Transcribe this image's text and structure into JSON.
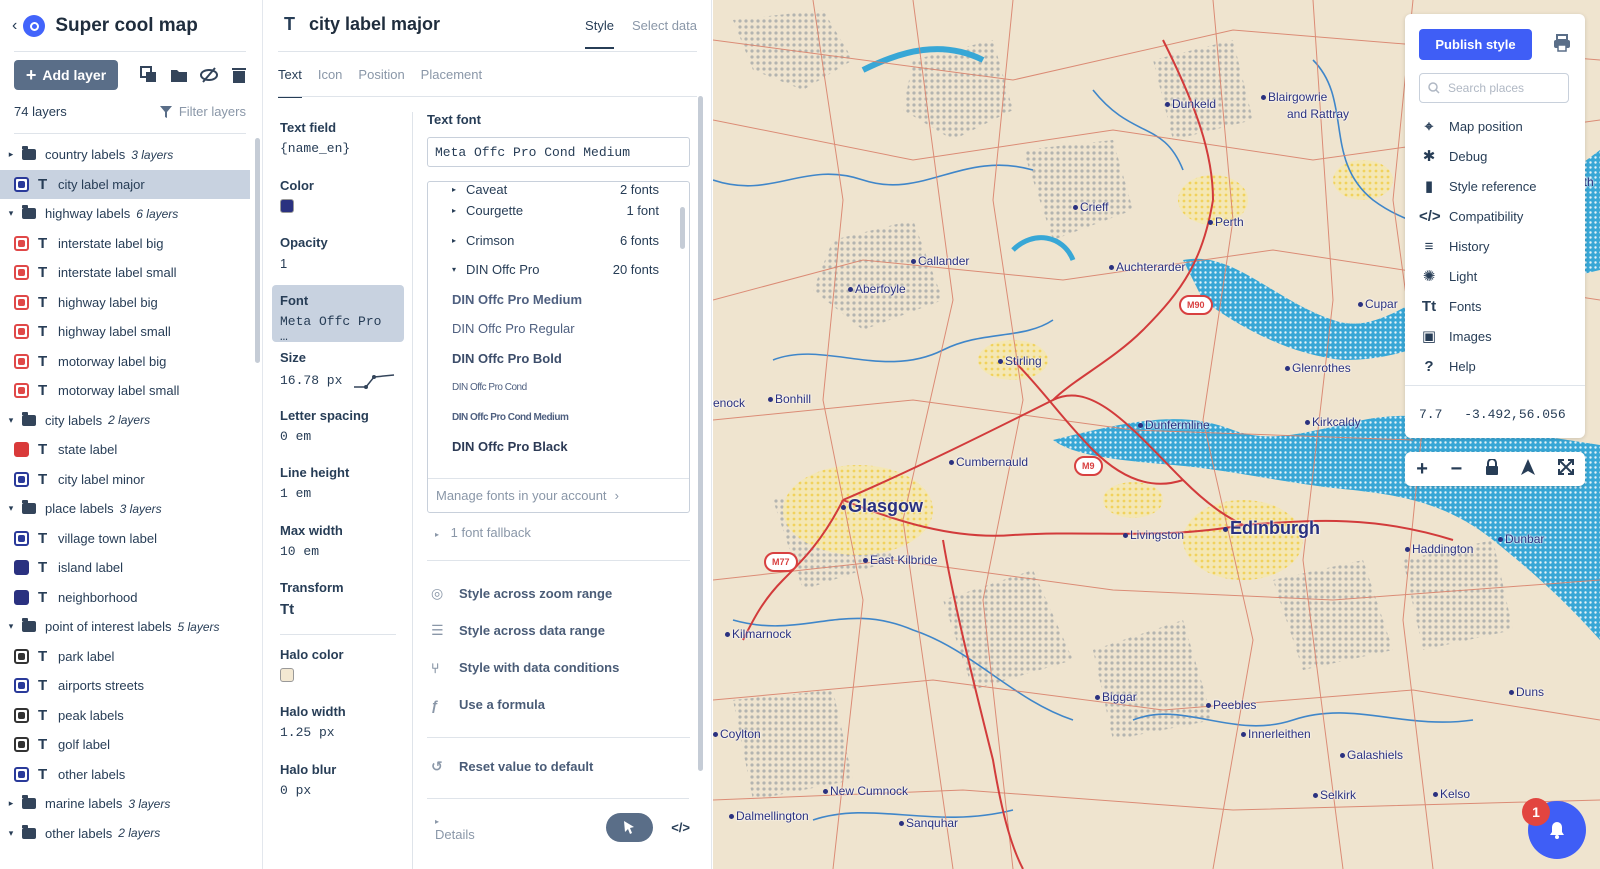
{
  "app": {
    "title": "Super cool map",
    "back_glyph": "‹"
  },
  "layers_panel": {
    "add_layer_label": "Add layer",
    "layer_count": "74 layers",
    "filter_label": "Filter layers",
    "items": [
      {
        "kind": "group",
        "caret": "▸",
        "label": "country labels",
        "count": "3 layers"
      },
      {
        "kind": "layer",
        "swatch": "blue",
        "label": "city label major",
        "selected": true
      },
      {
        "kind": "group",
        "caret": "▾",
        "label": "highway labels",
        "count": "6 layers"
      },
      {
        "kind": "layer",
        "swatch": "red",
        "label": "interstate label big"
      },
      {
        "kind": "layer",
        "swatch": "red",
        "label": "interstate label small"
      },
      {
        "kind": "layer",
        "swatch": "red",
        "label": "highway label big"
      },
      {
        "kind": "layer",
        "swatch": "red",
        "label": "highway label small"
      },
      {
        "kind": "layer",
        "swatch": "red",
        "label": "motorway label big"
      },
      {
        "kind": "layer",
        "swatch": "red",
        "label": "motorway label small"
      },
      {
        "kind": "group",
        "caret": "▾",
        "label": "city labels",
        "count": "2 layers"
      },
      {
        "kind": "layer",
        "swatch": "fill-red",
        "label": "state label"
      },
      {
        "kind": "layer",
        "swatch": "blue",
        "label": "city label minor"
      },
      {
        "kind": "group",
        "caret": "▾",
        "label": "place labels",
        "count": "3 layers"
      },
      {
        "kind": "layer",
        "swatch": "blue",
        "label": "village town label"
      },
      {
        "kind": "layer",
        "swatch": "fill-navy",
        "label": "island label"
      },
      {
        "kind": "layer",
        "swatch": "fill-navy",
        "label": "neighborhood"
      },
      {
        "kind": "group",
        "caret": "▾",
        "label": "point of interest labels",
        "count": "5 layers"
      },
      {
        "kind": "layer",
        "swatch": "dark",
        "label": "park label"
      },
      {
        "kind": "layer",
        "swatch": "blue",
        "label": "airports streets"
      },
      {
        "kind": "layer",
        "swatch": "dark",
        "label": "peak labels"
      },
      {
        "kind": "layer",
        "swatch": "dark",
        "label": "golf label"
      },
      {
        "kind": "layer",
        "swatch": "blue",
        "label": "other labels"
      },
      {
        "kind": "group",
        "caret": "▸",
        "label": "marine labels",
        "count": "3 layers"
      },
      {
        "kind": "group",
        "caret": "▾",
        "label": "other labels",
        "count": "2 layers"
      }
    ]
  },
  "editor": {
    "layer_name": "city label major",
    "type_glyph": "T",
    "top_tabs": [
      "Style",
      "Select data"
    ],
    "tabs": [
      "Text",
      "Icon",
      "Position",
      "Placement"
    ],
    "properties": [
      {
        "label": "Text field",
        "value": "{name_en}",
        "mono": true
      },
      {
        "label": "Color",
        "color": "#2a3180"
      },
      {
        "label": "Opacity",
        "value": "1"
      },
      {
        "label": "Font",
        "value": "Meta Offc Pro …",
        "mono": true,
        "active": true
      },
      {
        "label": "Size",
        "value": "16.78 px",
        "mono": true,
        "curve": true
      },
      {
        "label": "Letter spacing",
        "value": "0 em",
        "mono": true
      },
      {
        "label": "Line height",
        "value": "1 em",
        "mono": true
      },
      {
        "label": "Max width",
        "value": "10 em",
        "mono": true
      },
      {
        "label": "Transform",
        "glyph": "Tt"
      },
      {
        "label": "Halo color",
        "color": "#f3e8d2"
      },
      {
        "label": "Halo width",
        "value": "1.25 px",
        "mono": true
      },
      {
        "label": "Halo blur",
        "value": "0 px",
        "mono": true
      }
    ],
    "font_section": {
      "label": "Text font",
      "input_value": "Meta Offc Pro Cond Medium",
      "families": [
        {
          "caret": "▸",
          "name": "Caveat",
          "count": "2 fonts"
        },
        {
          "caret": "▸",
          "name": "Courgette",
          "count": "1 font"
        },
        {
          "caret": "▸",
          "name": "Crimson",
          "count": "6 fonts"
        },
        {
          "caret": "▾",
          "name": "DIN Offc Pro",
          "count": "20 fonts"
        }
      ],
      "fonts": [
        {
          "name": "DIN Offc Pro Medium",
          "style": "med"
        },
        {
          "name": "DIN Offc Pro Regular",
          "style": ""
        },
        {
          "name": "DIN Offc Pro Bold",
          "style": "bold"
        },
        {
          "name": "DIN Offc Pro Cond",
          "style": "cond"
        },
        {
          "name": "DIN Offc Pro Cond Medium",
          "style": "condmed"
        },
        {
          "name": "DIN Offc Pro Black",
          "style": "black"
        }
      ],
      "manage_label": "Manage fonts in your account",
      "fallback_label": "1 font fallback"
    },
    "actions": [
      {
        "icon": "zoom-range-icon",
        "glyph": "◎",
        "label": "Style across zoom range"
      },
      {
        "icon": "data-range-icon",
        "glyph": "☰",
        "label": "Style across data range"
      },
      {
        "icon": "data-conditions-icon",
        "glyph": "⑂",
        "label": "Style with data conditions"
      },
      {
        "icon": "formula-icon",
        "glyph": "ƒ",
        "label": "Use a formula"
      }
    ],
    "reset_label": "Reset value to default",
    "reset_glyph": "↺",
    "details_label": "Details",
    "code_label": "</>"
  },
  "map": {
    "overlay": {
      "publish_label": "Publish style",
      "search_placeholder": "Search places",
      "menu": [
        {
          "icon": "target-icon",
          "glyph": "⌖",
          "label": "Map position"
        },
        {
          "icon": "bug-icon",
          "glyph": "✱",
          "label": "Debug"
        },
        {
          "icon": "book-icon",
          "glyph": "▮",
          "label": "Style reference"
        },
        {
          "icon": "code-icon",
          "glyph": "</>",
          "label": "Compatibility"
        },
        {
          "icon": "history-icon",
          "glyph": "≡",
          "label": "History"
        },
        {
          "icon": "light-icon",
          "glyph": "✺",
          "label": "Light"
        },
        {
          "icon": "fonts-icon",
          "glyph": "Tt",
          "label": "Fonts"
        },
        {
          "icon": "images-icon",
          "glyph": "▣",
          "label": "Images"
        },
        {
          "icon": "help-icon",
          "glyph": "?",
          "label": "Help"
        }
      ],
      "zoom": "7.7",
      "coordinates": "-3.492,56.056"
    },
    "controls": {
      "zoom_in": "+",
      "zoom_out": "−",
      "lock": "🔒",
      "compass": "➤",
      "fullscreen": "⤢"
    },
    "notification_count": "1",
    "cities": [
      {
        "name": "Glasgow",
        "big": true
      },
      {
        "name": "Edinburgh",
        "big": true
      },
      {
        "name": "Dunkeld"
      },
      {
        "name": "Blairgowrie"
      },
      {
        "name": "and Rattray"
      },
      {
        "name": "Crieff"
      },
      {
        "name": "Perth"
      },
      {
        "name": "Callander"
      },
      {
        "name": "Auchterarder"
      },
      {
        "name": "Aberfoyle"
      },
      {
        "name": "Cupar"
      },
      {
        "name": "Stirling"
      },
      {
        "name": "Glenrothes"
      },
      {
        "name": "Bonhill"
      },
      {
        "name": "Dunfermline"
      },
      {
        "name": "Kirkcaldy"
      },
      {
        "name": "enock"
      },
      {
        "name": "Cumbernauld"
      },
      {
        "name": "Livingston"
      },
      {
        "name": "Dunbar"
      },
      {
        "name": "East Kilbride"
      },
      {
        "name": "Haddington"
      },
      {
        "name": "Kilmarnock"
      },
      {
        "name": "Biggar"
      },
      {
        "name": "Peebles"
      },
      {
        "name": "Duns"
      },
      {
        "name": "Coylton"
      },
      {
        "name": "Innerleithen"
      },
      {
        "name": "Galashiels"
      },
      {
        "name": "New Cumnock"
      },
      {
        "name": "Selkirk"
      },
      {
        "name": "Kelso"
      },
      {
        "name": "Dalmellington"
      },
      {
        "name": "Sanquhar"
      },
      {
        "name": "ith"
      }
    ],
    "shields": [
      "M90",
      "M9",
      "M77"
    ]
  }
}
